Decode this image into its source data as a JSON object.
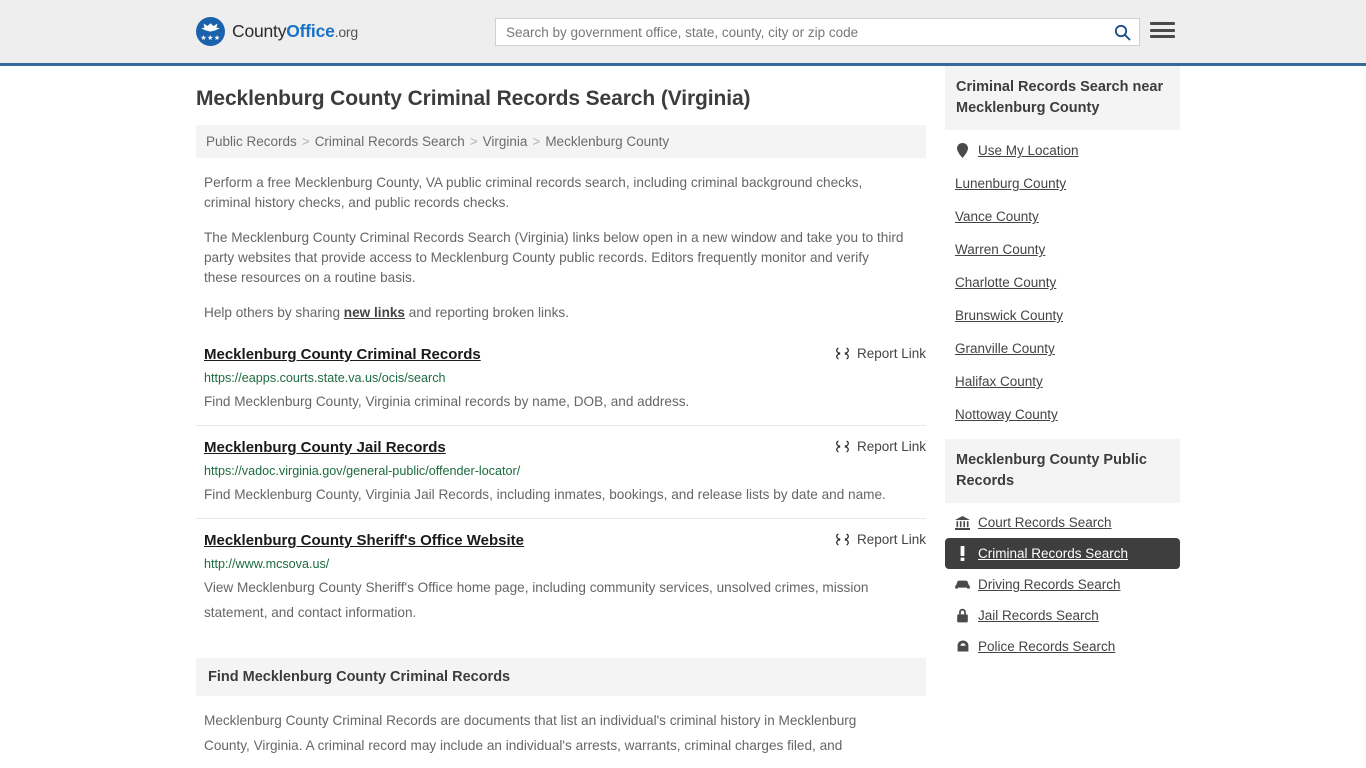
{
  "header": {
    "logo": {
      "part1": "County",
      "part2": "Office",
      "part3": ".org",
      "stars": "★★★"
    },
    "search": {
      "placeholder": "Search by government office, state, county, city or zip code",
      "value": "",
      "icon": "search-icon"
    },
    "menu_icon": "hamburger-menu-icon"
  },
  "page": {
    "title": "Mecklenburg County Criminal Records Search (Virginia)"
  },
  "breadcrumb": {
    "items": [
      {
        "label": "Public Records",
        "link": true
      },
      {
        "label": "Criminal Records Search",
        "link": true
      },
      {
        "label": "Virginia",
        "link": true
      },
      {
        "label": "Mecklenburg County",
        "link": false
      }
    ],
    "separator": ">"
  },
  "intro": {
    "para1": "Perform a free Mecklenburg County, VA public criminal records search, including criminal background checks, criminal history checks, and public records checks.",
    "para2": "The Mecklenburg County Criminal Records Search (Virginia) links below open in a new window and take you to third party websites that provide access to Mecklenburg County public records. Editors frequently monitor and verify these resources on a routine basis.",
    "para3_before": "Help others by sharing ",
    "para3_link": "new links",
    "para3_after": " and reporting broken links."
  },
  "results": {
    "report_label": "Report Link",
    "report_icon": "broken-link-icon",
    "items": [
      {
        "title": "Mecklenburg County Criminal Records",
        "url": "https://eapps.courts.state.va.us/ocis/search",
        "desc": "Find Mecklenburg County, Virginia criminal records by name, DOB, and address."
      },
      {
        "title": "Mecklenburg County Jail Records",
        "url": "https://vadoc.virginia.gov/general-public/offender-locator/",
        "desc": "Find Mecklenburg County, Virginia Jail Records, including inmates, bookings, and release lists by date and name."
      },
      {
        "title": "Mecklenburg County Sheriff's Office Website",
        "url": "http://www.mcsova.us/",
        "desc": "View Mecklenburg County Sheriff's Office home page, including community services, unsolved crimes, mission statement, and contact information."
      }
    ]
  },
  "find_section": {
    "heading": "Find Mecklenburg County Criminal Records",
    "body": "Mecklenburg County Criminal Records are documents that list an individual's criminal history in Mecklenburg County, Virginia. A criminal record may include an individual's arrests, warrants, criminal charges filed, and"
  },
  "sidebar": {
    "nearby": {
      "heading": "Criminal Records Search near Mecklenburg County",
      "items": [
        {
          "label": "Use My Location",
          "icon": "map-pin-icon"
        },
        {
          "label": "Lunenburg County",
          "icon": ""
        },
        {
          "label": "Vance County",
          "icon": ""
        },
        {
          "label": "Warren County",
          "icon": ""
        },
        {
          "label": "Charlotte County",
          "icon": ""
        },
        {
          "label": "Brunswick County",
          "icon": ""
        },
        {
          "label": "Granville County",
          "icon": ""
        },
        {
          "label": "Halifax County",
          "icon": ""
        },
        {
          "label": "Nottoway County",
          "icon": ""
        }
      ]
    },
    "public_records": {
      "heading": "Mecklenburg County Public Records",
      "items": [
        {
          "label": "Court Records Search",
          "icon": "courthouse-icon",
          "active": false
        },
        {
          "label": "Criminal Records Search",
          "icon": "exclamation-icon",
          "active": true
        },
        {
          "label": "Driving Records Search",
          "icon": "car-icon",
          "active": false
        },
        {
          "label": "Jail Records Search",
          "icon": "lock-icon",
          "active": false
        },
        {
          "label": "Police Records Search",
          "icon": "police-badge-icon",
          "active": false
        }
      ]
    }
  },
  "colors": {
    "header_bg": "#eeeeee",
    "header_border": "#36699e",
    "brand_blue": "#1b72c4",
    "panel_bg": "#f4f4f4",
    "url_green": "#1d6b3f",
    "active_bg": "#3e3e3e",
    "body_text": "#666666"
  }
}
